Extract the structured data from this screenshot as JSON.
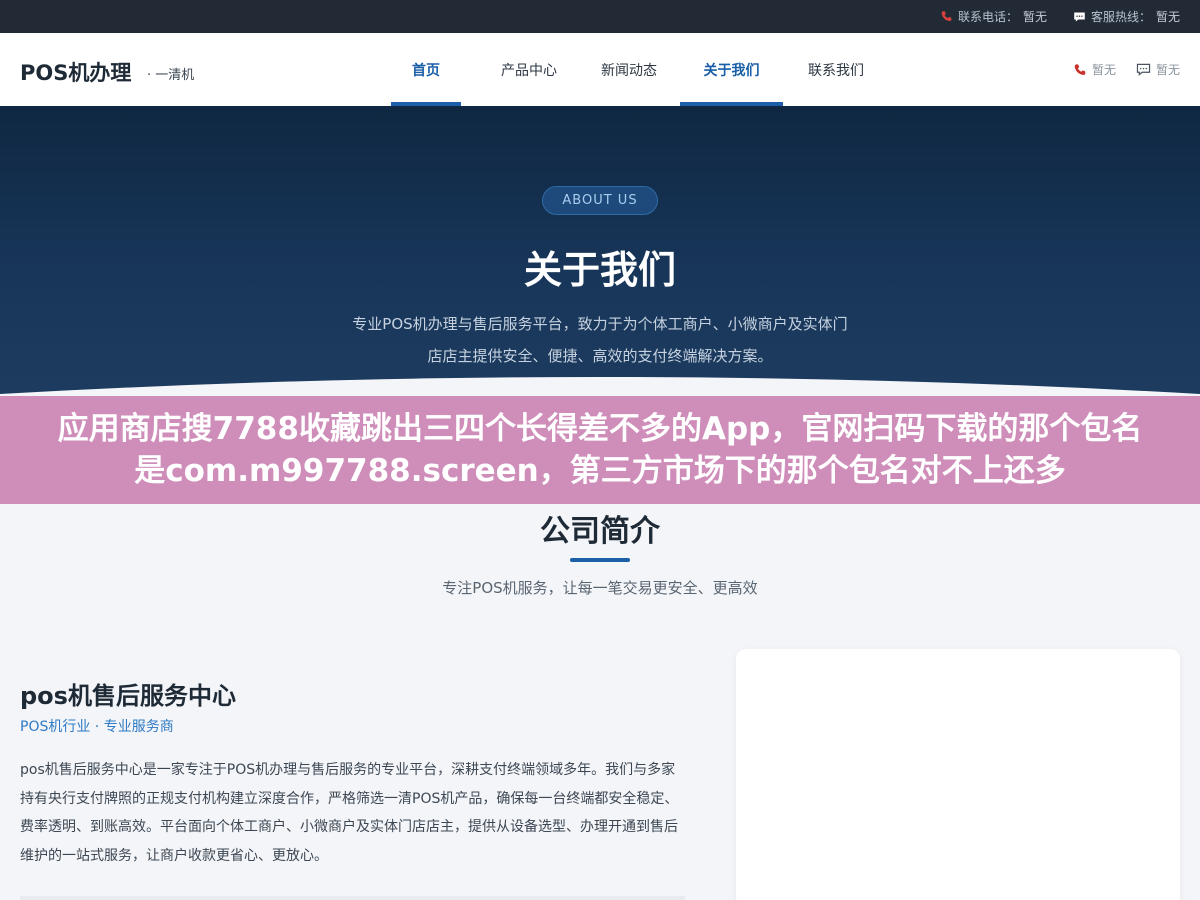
{
  "topbar": {
    "phone_label": "联系电话：",
    "phone_value": "暂无",
    "hotline_label": "客服热线：",
    "hotline_value": "暂无",
    "phone_icon": "phone-icon",
    "chat_icon": "chat-icon"
  },
  "header": {
    "logo": "POS机办理",
    "logo_sub": "· 一清机",
    "nav": [
      {
        "label": "首页",
        "active": true
      },
      {
        "label": "产品中心",
        "active": false
      },
      {
        "label": "新闻动态",
        "active": false
      },
      {
        "label": "关于我们",
        "active": true
      },
      {
        "label": "联系我们",
        "active": false
      }
    ],
    "right_phone": "暂无",
    "right_chat": "暂无"
  },
  "hero": {
    "badge": "ABOUT US",
    "title": "关于我们",
    "desc_line1": "专业POS机办理与售后服务平台，致力于为个体工商户、小微商户及实体门",
    "desc_line2": "店店主提供安全、便捷、高效的支付终端解决方案。"
  },
  "banner": {
    "text": "应用商店搜7788收藏跳出三四个长得差不多的App，官网扫码下载的那个包名是com.m997788.screen，第三方市场下的那个包名对不上还多"
  },
  "intro": {
    "title": "公司简介",
    "subtitle": "专注POS机服务，让每一笔交易更安全、更高效",
    "company_name": "pos机售后服务中心",
    "company_tag": "POS机行业 · 专业服务商",
    "company_desc": "pos机售后服务中心是一家专注于POS机办理与售后服务的专业平台，深耕支付终端领域多年。我们与多家持有央行支付牌照的正规支付机构建立深度合作，严格筛选一清POS机产品，确保每一台终端都安全稳定、费率透明、到账高效。平台面向个体工商户、小微商户及实体门店店主，提供从设备选型、办理开通到售后维护的一站式服务，让商户收款更省心、更放心。"
  },
  "colors": {
    "accent": "#1a5fa8",
    "topbar_bg": "#222a36",
    "hero_bg": "#18365a",
    "banner_bg": "#cf8db9",
    "page_bg": "#f3f5f8"
  }
}
